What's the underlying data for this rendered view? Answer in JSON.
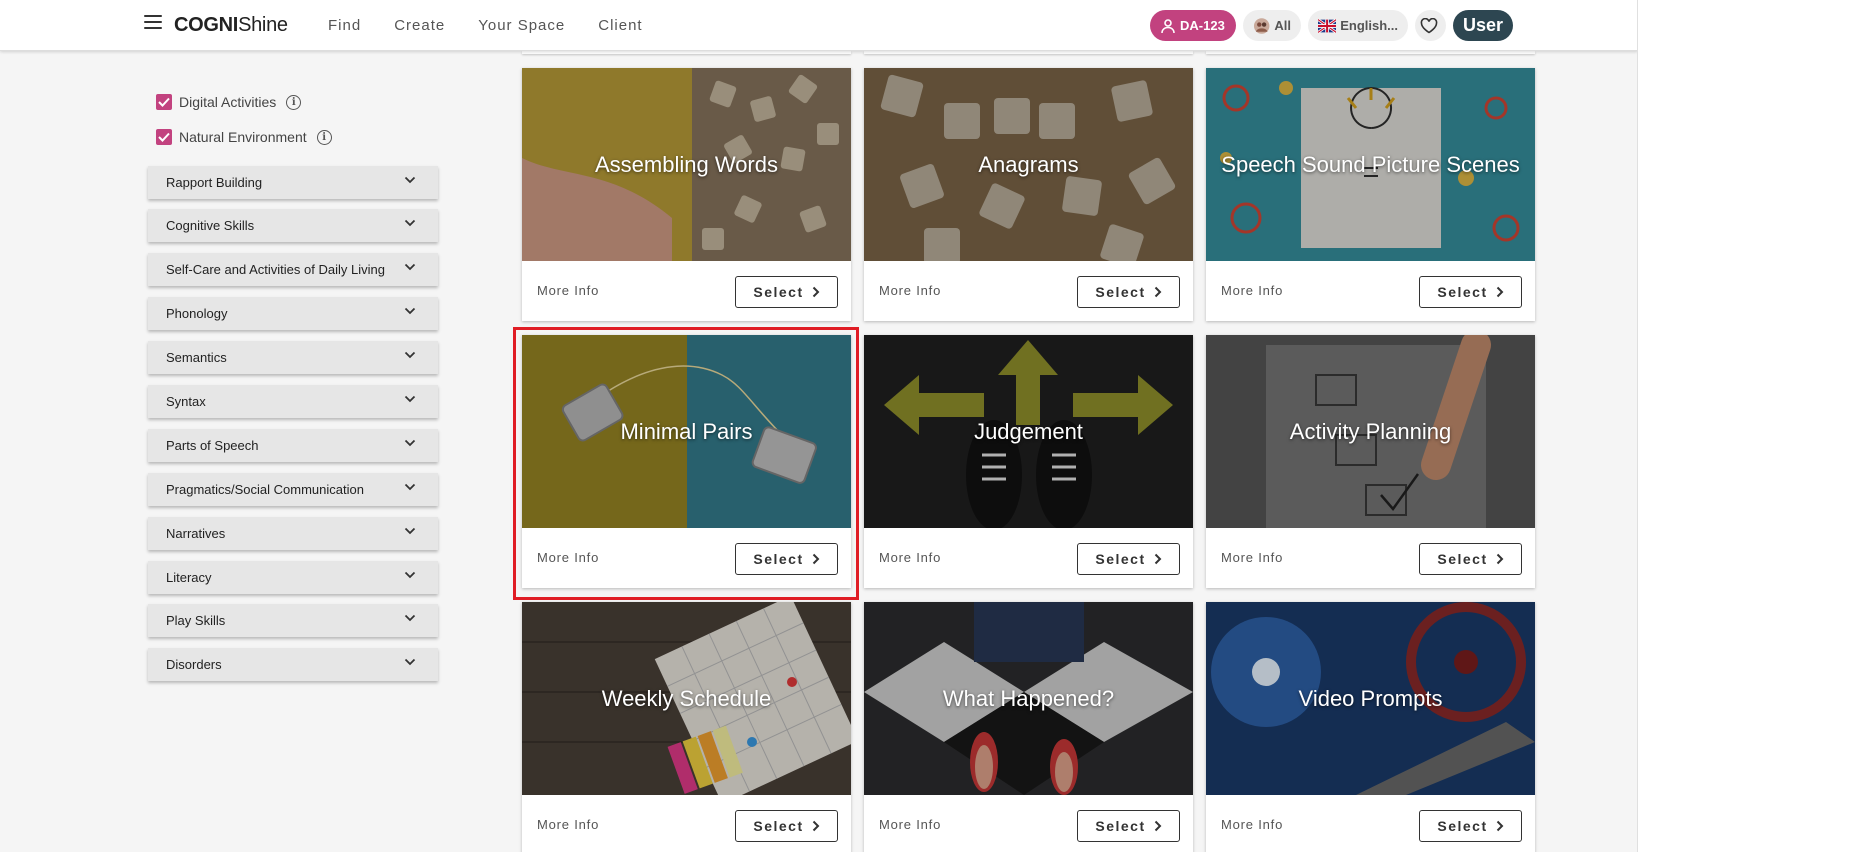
{
  "header": {
    "logo_bold": "COGNI",
    "logo_light": "Shine",
    "nav": [
      "Find",
      "Create",
      "Your Space",
      "Client"
    ],
    "profile_code": "DA-123",
    "filter_all": "All",
    "language": "English...",
    "user_label": "User",
    "accent_color": "#c2427f",
    "user_color": "#2d4651"
  },
  "filters": {
    "checkboxes": [
      {
        "label": "Digital Activities",
        "checked": true
      },
      {
        "label": "Natural Environment",
        "checked": true
      }
    ],
    "categories": [
      "Rapport Building",
      "Cognitive Skills",
      "Self-Care and Activities of Daily Living",
      "Phonology",
      "Semantics",
      "Syntax",
      "Parts of Speech",
      "Pragmatics/Social Communication",
      "Narratives",
      "Literacy",
      "Play Skills",
      "Disorders"
    ]
  },
  "cards": [
    {
      "title": "Assembling Words",
      "more": "More Info",
      "select": "Select"
    },
    {
      "title": "Anagrams",
      "more": "More Info",
      "select": "Select"
    },
    {
      "title": "Speech Sound Picture Scenes",
      "more": "More Info",
      "select": "Select"
    },
    {
      "title": "Minimal Pairs",
      "more": "More Info",
      "select": "Select"
    },
    {
      "title": "Judgement",
      "more": "More Info",
      "select": "Select"
    },
    {
      "title": "Activity Planning",
      "more": "More Info",
      "select": "Select"
    },
    {
      "title": "Weekly Schedule",
      "more": "More Info",
      "select": "Select"
    },
    {
      "title": "What Happened?",
      "more": "More Info",
      "select": "Select"
    },
    {
      "title": "Video Prompts",
      "more": "More Info",
      "select": "Select"
    }
  ],
  "highlight_color": "#e01d25"
}
